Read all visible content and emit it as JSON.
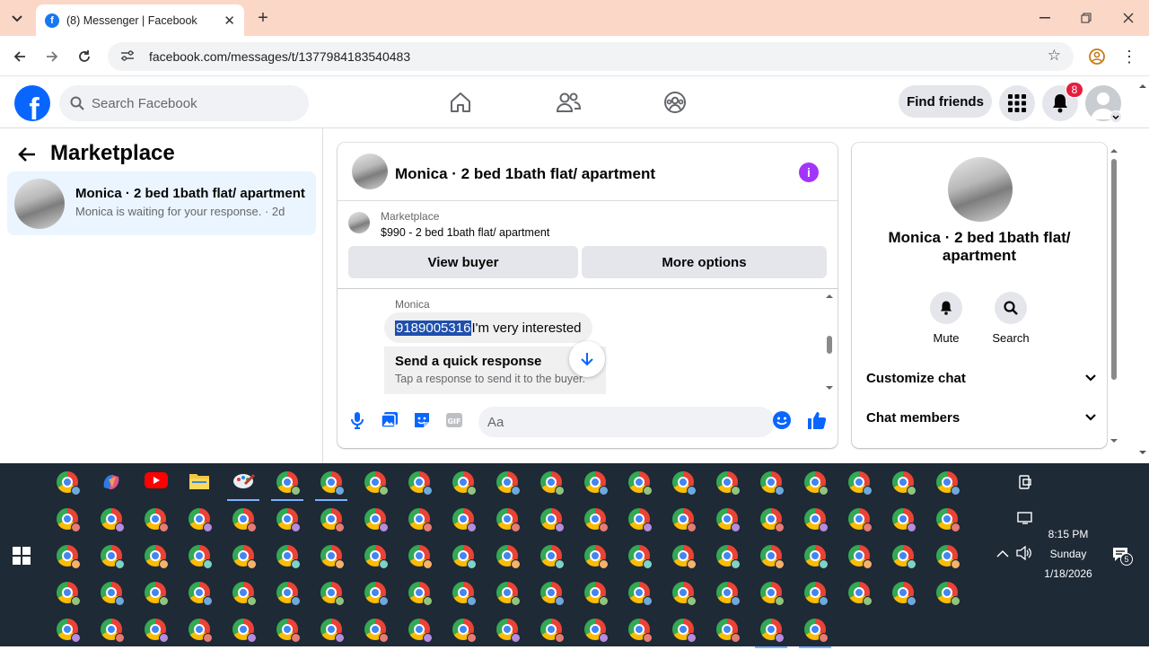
{
  "browser": {
    "tab_title": "(8) Messenger | Facebook",
    "url": "facebook.com/messages/t/1377984183540483"
  },
  "fb": {
    "search_placeholder": "Search Facebook",
    "find_friends": "Find friends",
    "notification_count": "8"
  },
  "left": {
    "title": "Marketplace",
    "conversation": {
      "name": "Monica · 2 bed 1bath flat/ apartment",
      "preview": "Monica is waiting for your response. · 2d"
    }
  },
  "chat": {
    "title": "Monica · 2 bed 1bath flat/ apartment",
    "marketplace_label": "Marketplace",
    "listing": "$990 - 2 bed 1bath flat/ apartment",
    "view_buyer": "View buyer",
    "more_options": "More options",
    "sender": "Monica",
    "message_selected": "9189005316 ",
    "message_rest": "I'm very interested",
    "quick_response_title": "Send a quick response",
    "quick_response_sub": "Tap a response to send it to the buyer.",
    "input_placeholder": "Aa"
  },
  "right": {
    "name": "Monica · 2 bed 1bath flat/ apartment",
    "mute": "Mute",
    "search": "Search",
    "customize_chat": "Customize chat",
    "chat_members": "Chat members"
  },
  "taskbar": {
    "time": "8:15 PM",
    "day": "Sunday",
    "date": "1/18/2026",
    "notification_count": "5"
  },
  "colors": {
    "fb_blue": "#0866ff",
    "accent_purple": "#a334fa",
    "selection": "#1f4fad",
    "tab_strip": "#fbd7c7"
  }
}
